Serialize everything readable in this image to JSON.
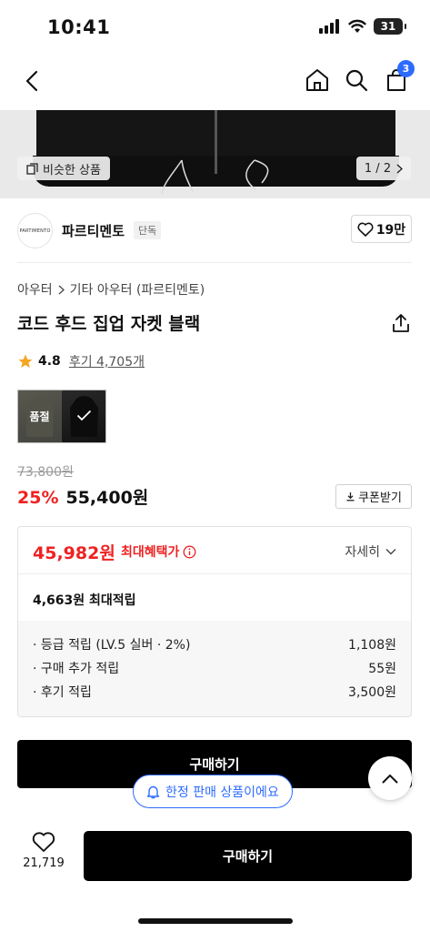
{
  "status_bar": {
    "time": "10:41",
    "battery": "31"
  },
  "nav": {
    "cart_count": "3"
  },
  "hero": {
    "similar_label": "비슷한 상품",
    "pager": "1 / 2"
  },
  "brand": {
    "logo_text": "PARTIMENTO",
    "name": "파르티멘토",
    "tag": "단독",
    "likes": "19만"
  },
  "product": {
    "breadcrumb": [
      "아우터",
      "기타 아우터 (파르티멘토)"
    ],
    "title": "코드 후드 집업 자켓 블랙",
    "rating": "4.8",
    "reviews": "후기 4,705개",
    "sold_out_label": "품절",
    "original_price": "73,800원",
    "discount": "25%",
    "price": "55,400원",
    "coupon_label": "쿠폰받기"
  },
  "benefit": {
    "max_price": "45,982원",
    "max_label": "최대혜택가",
    "detail_label": "자세히",
    "points_total": "4,663원 최대적립",
    "points": [
      {
        "label": "· 등급 적립 (LV.5 실버 · 2%)",
        "value": "1,108원"
      },
      {
        "label": "· 구매 추가 적립",
        "value": "55원"
      },
      {
        "label": "· 후기 적립",
        "value": "3,500원"
      }
    ]
  },
  "buy": {
    "main_label": "구매하기",
    "limited_label": "한정 판매 상품이에요",
    "bottom_label": "구매하기",
    "wish_count": "21,719"
  },
  "colors": {
    "accent_blue": "#2d6bff",
    "sale_red": "#ee2222"
  }
}
